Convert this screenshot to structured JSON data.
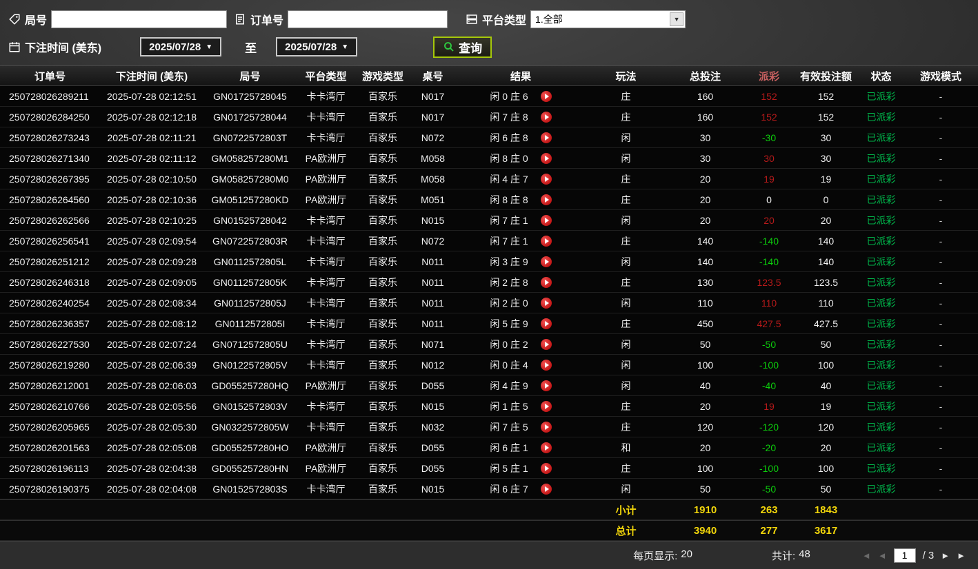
{
  "filters": {
    "round_label": "局号",
    "round_value": "",
    "order_label": "订单号",
    "order_value": "",
    "platform_label": "平台类型",
    "platform_value": "1.全部",
    "bet_time_label": "下注时间 (美东)",
    "date_from": "2025/07/28",
    "to_label": "至",
    "date_to": "2025/07/28",
    "query_label": "查询",
    "accent_border_color": "#a6c80a",
    "search_icon_color": "#2ecc40"
  },
  "table": {
    "headers": [
      "订单号",
      "下注时间 (美东)",
      "局号",
      "平台类型",
      "游戏类型",
      "桌号",
      "结果",
      "玩法",
      "总投注",
      "派彩",
      "有效投注额",
      "状态",
      "游戏模式"
    ],
    "payout_red": "#b51a1a",
    "payout_green": "#0ccc0c",
    "status_green": "#00b44a",
    "summary_yellow": "#f2d60a",
    "rows": [
      {
        "order": "250728026289211",
        "time": "2025-07-28 02:12:51",
        "round": "GN01725728045",
        "platform": "卡卡湾厅",
        "game": "百家乐",
        "table": "N017",
        "result": "闲 0 庄 6",
        "play": "庄",
        "total": "160",
        "payout": "152",
        "payout_color": "red",
        "valid": "152",
        "status": "已派彩",
        "mode": "-"
      },
      {
        "order": "250728026284250",
        "time": "2025-07-28 02:12:18",
        "round": "GN01725728044",
        "platform": "卡卡湾厅",
        "game": "百家乐",
        "table": "N017",
        "result": "闲 7 庄 8",
        "play": "庄",
        "total": "160",
        "payout": "152",
        "payout_color": "red",
        "valid": "152",
        "status": "已派彩",
        "mode": "-"
      },
      {
        "order": "250728026273243",
        "time": "2025-07-28 02:11:21",
        "round": "GN0722572803T",
        "platform": "卡卡湾厅",
        "game": "百家乐",
        "table": "N072",
        "result": "闲 6 庄 8",
        "play": "闲",
        "total": "30",
        "payout": "-30",
        "payout_color": "green",
        "valid": "30",
        "status": "已派彩",
        "mode": "-"
      },
      {
        "order": "250728026271340",
        "time": "2025-07-28 02:11:12",
        "round": "GM058257280M1",
        "platform": "PA欧洲厅",
        "game": "百家乐",
        "table": "M058",
        "result": "闲 8 庄 0",
        "play": "闲",
        "total": "30",
        "payout": "30",
        "payout_color": "red",
        "valid": "30",
        "status": "已派彩",
        "mode": "-"
      },
      {
        "order": "250728026267395",
        "time": "2025-07-28 02:10:50",
        "round": "GM058257280M0",
        "platform": "PA欧洲厅",
        "game": "百家乐",
        "table": "M058",
        "result": "闲 4 庄 7",
        "play": "庄",
        "total": "20",
        "payout": "19",
        "payout_color": "red",
        "valid": "19",
        "status": "已派彩",
        "mode": "-"
      },
      {
        "order": "250728026264560",
        "time": "2025-07-28 02:10:36",
        "round": "GM051257280KD",
        "platform": "PA欧洲厅",
        "game": "百家乐",
        "table": "M051",
        "result": "闲 8 庄 8",
        "play": "庄",
        "total": "20",
        "payout": "0",
        "payout_color": "white",
        "valid": "0",
        "status": "已派彩",
        "mode": "-"
      },
      {
        "order": "250728026262566",
        "time": "2025-07-28 02:10:25",
        "round": "GN01525728042",
        "platform": "卡卡湾厅",
        "game": "百家乐",
        "table": "N015",
        "result": "闲 7 庄 1",
        "play": "闲",
        "total": "20",
        "payout": "20",
        "payout_color": "red",
        "valid": "20",
        "status": "已派彩",
        "mode": "-"
      },
      {
        "order": "250728026256541",
        "time": "2025-07-28 02:09:54",
        "round": "GN0722572803R",
        "platform": "卡卡湾厅",
        "game": "百家乐",
        "table": "N072",
        "result": "闲 7 庄 1",
        "play": "庄",
        "total": "140",
        "payout": "-140",
        "payout_color": "green",
        "valid": "140",
        "status": "已派彩",
        "mode": "-"
      },
      {
        "order": "250728026251212",
        "time": "2025-07-28 02:09:28",
        "round": "GN0112572805L",
        "platform": "卡卡湾厅",
        "game": "百家乐",
        "table": "N011",
        "result": "闲 3 庄 9",
        "play": "闲",
        "total": "140",
        "payout": "-140",
        "payout_color": "green",
        "valid": "140",
        "status": "已派彩",
        "mode": "-"
      },
      {
        "order": "250728026246318",
        "time": "2025-07-28 02:09:05",
        "round": "GN0112572805K",
        "platform": "卡卡湾厅",
        "game": "百家乐",
        "table": "N011",
        "result": "闲 2 庄 8",
        "play": "庄",
        "total": "130",
        "payout": "123.5",
        "payout_color": "red",
        "valid": "123.5",
        "status": "已派彩",
        "mode": "-"
      },
      {
        "order": "250728026240254",
        "time": "2025-07-28 02:08:34",
        "round": "GN0112572805J",
        "platform": "卡卡湾厅",
        "game": "百家乐",
        "table": "N011",
        "result": "闲 2 庄 0",
        "play": "闲",
        "total": "110",
        "payout": "110",
        "payout_color": "red",
        "valid": "110",
        "status": "已派彩",
        "mode": "-"
      },
      {
        "order": "250728026236357",
        "time": "2025-07-28 02:08:12",
        "round": "GN0112572805I",
        "platform": "卡卡湾厅",
        "game": "百家乐",
        "table": "N011",
        "result": "闲 5 庄 9",
        "play": "庄",
        "total": "450",
        "payout": "427.5",
        "payout_color": "red",
        "valid": "427.5",
        "status": "已派彩",
        "mode": "-"
      },
      {
        "order": "250728026227530",
        "time": "2025-07-28 02:07:24",
        "round": "GN0712572805U",
        "platform": "卡卡湾厅",
        "game": "百家乐",
        "table": "N071",
        "result": "闲 0 庄 2",
        "play": "闲",
        "total": "50",
        "payout": "-50",
        "payout_color": "green",
        "valid": "50",
        "status": "已派彩",
        "mode": "-"
      },
      {
        "order": "250728026219280",
        "time": "2025-07-28 02:06:39",
        "round": "GN0122572805V",
        "platform": "卡卡湾厅",
        "game": "百家乐",
        "table": "N012",
        "result": "闲 0 庄 4",
        "play": "闲",
        "total": "100",
        "payout": "-100",
        "payout_color": "green",
        "valid": "100",
        "status": "已派彩",
        "mode": "-"
      },
      {
        "order": "250728026212001",
        "time": "2025-07-28 02:06:03",
        "round": "GD055257280HQ",
        "platform": "PA欧洲厅",
        "game": "百家乐",
        "table": "D055",
        "result": "闲 4 庄 9",
        "play": "闲",
        "total": "40",
        "payout": "-40",
        "payout_color": "green",
        "valid": "40",
        "status": "已派彩",
        "mode": "-"
      },
      {
        "order": "250728026210766",
        "time": "2025-07-28 02:05:56",
        "round": "GN0152572803V",
        "platform": "卡卡湾厅",
        "game": "百家乐",
        "table": "N015",
        "result": "闲 1 庄 5",
        "play": "庄",
        "total": "20",
        "payout": "19",
        "payout_color": "red",
        "valid": "19",
        "status": "已派彩",
        "mode": "-"
      },
      {
        "order": "250728026205965",
        "time": "2025-07-28 02:05:30",
        "round": "GN0322572805W",
        "platform": "卡卡湾厅",
        "game": "百家乐",
        "table": "N032",
        "result": "闲 7 庄 5",
        "play": "庄",
        "total": "120",
        "payout": "-120",
        "payout_color": "green",
        "valid": "120",
        "status": "已派彩",
        "mode": "-"
      },
      {
        "order": "250728026201563",
        "time": "2025-07-28 02:05:08",
        "round": "GD055257280HO",
        "platform": "PA欧洲厅",
        "game": "百家乐",
        "table": "D055",
        "result": "闲 6 庄 1",
        "play": "和",
        "total": "20",
        "payout": "-20",
        "payout_color": "green",
        "valid": "20",
        "status": "已派彩",
        "mode": "-"
      },
      {
        "order": "250728026196113",
        "time": "2025-07-28 02:04:38",
        "round": "GD055257280HN",
        "platform": "PA欧洲厅",
        "game": "百家乐",
        "table": "D055",
        "result": "闲 5 庄 1",
        "play": "庄",
        "total": "100",
        "payout": "-100",
        "payout_color": "green",
        "valid": "100",
        "status": "已派彩",
        "mode": "-"
      },
      {
        "order": "250728026190375",
        "time": "2025-07-28 02:04:08",
        "round": "GN0152572803S",
        "platform": "卡卡湾厅",
        "game": "百家乐",
        "table": "N015",
        "result": "闲 6 庄 7",
        "play": "闲",
        "total": "50",
        "payout": "-50",
        "payout_color": "green",
        "valid": "50",
        "status": "已派彩",
        "mode": "-"
      }
    ],
    "subtotal": {
      "label": "小计",
      "total": "1910",
      "payout": "263",
      "valid": "1843"
    },
    "grand_total": {
      "label": "总计",
      "total": "3940",
      "payout": "277",
      "valid": "3617"
    }
  },
  "pagination": {
    "per_page_label": "每页显示:",
    "per_page_value": "20",
    "total_label": "共计:",
    "total_value": "48",
    "page_value": "1",
    "page_total": "/ 3"
  }
}
